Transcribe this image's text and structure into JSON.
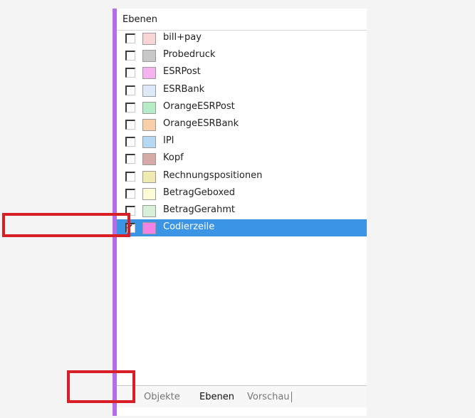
{
  "panel": {
    "title": "Ebenen"
  },
  "layers": [
    {
      "label": "bill+pay",
      "color": "#f8d6d6",
      "checked": false
    },
    {
      "label": "Probedruck",
      "color": "#c8c8c8",
      "checked": false
    },
    {
      "label": "ESRPost",
      "color": "#f7b3f0",
      "checked": false
    },
    {
      "label": "ESRBank",
      "color": "#dceaf8",
      "checked": false
    },
    {
      "label": "OrangeESRPost",
      "color": "#b6ecc8",
      "checked": false
    },
    {
      "label": "OrangeESRBank",
      "color": "#f8cfa8",
      "checked": false
    },
    {
      "label": "IPI",
      "color": "#b7d8f4",
      "checked": false
    },
    {
      "label": "Kopf",
      "color": "#d6aaa6",
      "checked": false
    },
    {
      "label": "Rechnungspositionen",
      "color": "#eeeab0",
      "checked": false
    },
    {
      "label": "BetragGeboxed",
      "color": "#fdfbd8",
      "checked": false
    },
    {
      "label": "BetragGerahmt",
      "color": "#d8f0d8",
      "checked": false
    },
    {
      "label": "Codierzeile",
      "color": "#f482e4",
      "checked": true,
      "selected": true
    }
  ],
  "tabs": {
    "objekte": "Objekte",
    "ebenen": "Ebenen",
    "vorschau": "Vorschau"
  },
  "colors": {
    "accent_bar": "#b46ee6",
    "selection": "#3c94e4",
    "highlight": "#d81f26"
  }
}
